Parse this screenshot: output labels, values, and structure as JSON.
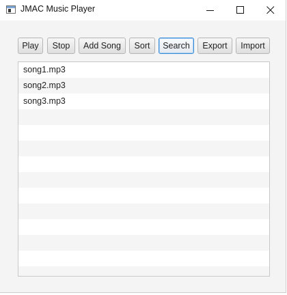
{
  "window": {
    "title": "JMAC Music Player",
    "controls": [
      "minimize",
      "maximize",
      "close"
    ]
  },
  "toolbar": {
    "buttons": [
      {
        "label": "Play"
      },
      {
        "label": "Stop"
      },
      {
        "label": "Add Song"
      },
      {
        "label": "Sort"
      },
      {
        "label": "Search",
        "focused": true
      },
      {
        "label": "Export"
      },
      {
        "label": "Import"
      }
    ]
  },
  "songs": [
    "song1.mp3",
    "song2.mp3",
    "song3.mp3"
  ],
  "colors": {
    "focus_border": "#3c8bd6",
    "stripe": "#f5f5f5"
  }
}
